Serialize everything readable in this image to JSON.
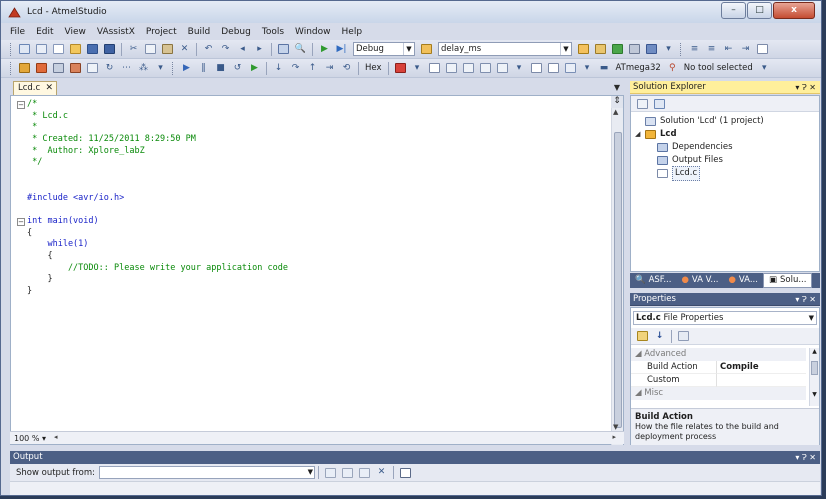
{
  "window": {
    "title": "Lcd - AtmelStudio",
    "minimize": "–",
    "maximize": "□",
    "close": "x"
  },
  "menu": [
    "File",
    "Edit",
    "View",
    "VAssistX",
    "Project",
    "Build",
    "Debug",
    "Tools",
    "Window",
    "Help"
  ],
  "toolbar1": {
    "config_value": "Debug",
    "function_value": "delay_ms"
  },
  "toolbar2": {
    "hex_label": "Hex",
    "device_label": "ATmega32",
    "tool_label": "No tool selected"
  },
  "editor": {
    "tab_label": "Lcd.c",
    "tab_close": "✕",
    "zoom": "100 %",
    "lines": [
      {
        "cls": "cmt",
        "text": "/*"
      },
      {
        "cls": "cmt",
        "text": " * Lcd.c"
      },
      {
        "cls": "cmt",
        "text": " *"
      },
      {
        "cls": "cmt",
        "text": " * Created: 11/25/2011 8:29:50 PM"
      },
      {
        "cls": "cmt",
        "text": " *  Author: Xplore_labZ"
      },
      {
        "cls": "cmt",
        "text": " */"
      },
      {
        "cls": "txt",
        "text": ""
      },
      {
        "cls": "txt",
        "text": ""
      },
      {
        "cls": "pp",
        "text": "#include <avr/io.h>"
      },
      {
        "cls": "txt",
        "text": ""
      },
      {
        "cls": "kw",
        "text": "int main(void)"
      },
      {
        "cls": "txt",
        "text": "{"
      },
      {
        "cls": "kw",
        "text": "    while(1)"
      },
      {
        "cls": "txt",
        "text": "    {"
      },
      {
        "cls": "cmt",
        "text": "        //TODO:: Please write your application code"
      },
      {
        "cls": "txt",
        "text": "    }"
      },
      {
        "cls": "txt",
        "text": "}"
      }
    ]
  },
  "solution_explorer": {
    "title": "Solution Explorer",
    "controls": "▾ Ɂ ✕",
    "solution": "Solution 'Lcd' (1 project)",
    "project": "Lcd",
    "dependencies": "Dependencies",
    "output_files": "Output Files",
    "file": "Lcd.c"
  },
  "bottom_tabs": [
    "ASF...",
    "VA V...",
    "VA...",
    "Solu..."
  ],
  "properties": {
    "title": "Properties",
    "controls": "▾ Ɂ ✕",
    "object": "Lcd.c",
    "object_type": "File Properties",
    "category_advanced": "Advanced",
    "category_misc": "Misc",
    "rows": [
      {
        "name": "Build Action",
        "value": "Compile"
      },
      {
        "name": "Custom Compilati",
        "value": ""
      }
    ],
    "desc_title": "Build Action",
    "desc_text": "How the file relates to the build and deployment process"
  },
  "output": {
    "title": "Output",
    "controls": "▾ Ɂ ✕",
    "show_from_label": "Show output from:",
    "show_from_value": ""
  },
  "colors": {
    "active_header": "#ffef9b",
    "inactive_header": "#4c5f85",
    "comment": "#0a8a0a",
    "keyword": "#1a23c8"
  }
}
